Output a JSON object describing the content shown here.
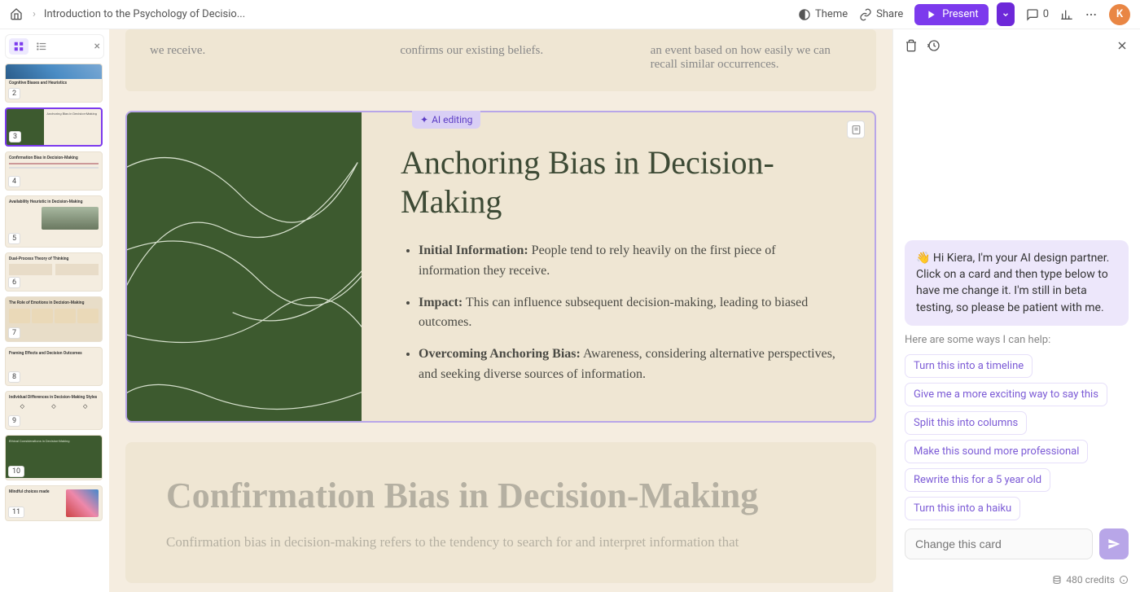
{
  "header": {
    "doc_title": "Introduction to the Psychology of Decisio...",
    "theme": "Theme",
    "share": "Share",
    "present": "Present",
    "comments_count": "0",
    "avatar_initial": "K"
  },
  "sidebar": {
    "thumbs": [
      {
        "num": "2",
        "title": "Cognitive Biases and Heuristics"
      },
      {
        "num": "3",
        "title": "Anchoring Bias in Decision-Making"
      },
      {
        "num": "4",
        "title": "Confirmation Bias in Decision-Making"
      },
      {
        "num": "5",
        "title": "Availability Heuristic in Decision-Making"
      },
      {
        "num": "6",
        "title": "Dual-Process Theory of Thinking"
      },
      {
        "num": "7",
        "title": "The Role of Emotions in Decision-Making"
      },
      {
        "num": "8",
        "title": "Framing Effects and Decision Outcomes"
      },
      {
        "num": "9",
        "title": "Individual Differences in Decision-Making Styles"
      },
      {
        "num": "10",
        "title": "Ethical Considerations in Decision-Making"
      },
      {
        "num": "11",
        "title": "Mindful choices made"
      }
    ]
  },
  "prev_card": {
    "col1": "we receive.",
    "col2": "confirms our existing beliefs.",
    "col3": "an event based on how easily we can recall similar occurrences."
  },
  "active_card": {
    "ai_badge": "AI editing",
    "title": "Anchoring Bias in Decision-Making",
    "bullets": [
      {
        "b": "Initial Information:",
        "t": " People tend to rely heavily on the first piece of information they receive."
      },
      {
        "b": "Impact:",
        "t": " This can influence subsequent decision-making, leading to biased outcomes."
      },
      {
        "b": "Overcoming Anchoring Bias:",
        "t": " Awareness, considering alternative perspectives, and seeking diverse sources of information."
      }
    ]
  },
  "next_card": {
    "title": "Confirmation Bias in Decision-Making",
    "body": "Confirmation bias in decision-making refers to the tendency to search for and interpret information that"
  },
  "ai": {
    "welcome": "👋 Hi Kiera, I'm your AI design partner. Click on a card and then type below to have me change it. I'm still in beta testing, so please be patient with me.",
    "help_label": "Here are some ways I can help:",
    "chips": [
      "Turn this into a timeline",
      "Give me a more exciting way to say this",
      "Split this into columns",
      "Make this sound more professional",
      "Rewrite this for a 5 year old",
      "Turn this into a haiku"
    ],
    "placeholder": "Change this card",
    "credits": "480 credits"
  }
}
